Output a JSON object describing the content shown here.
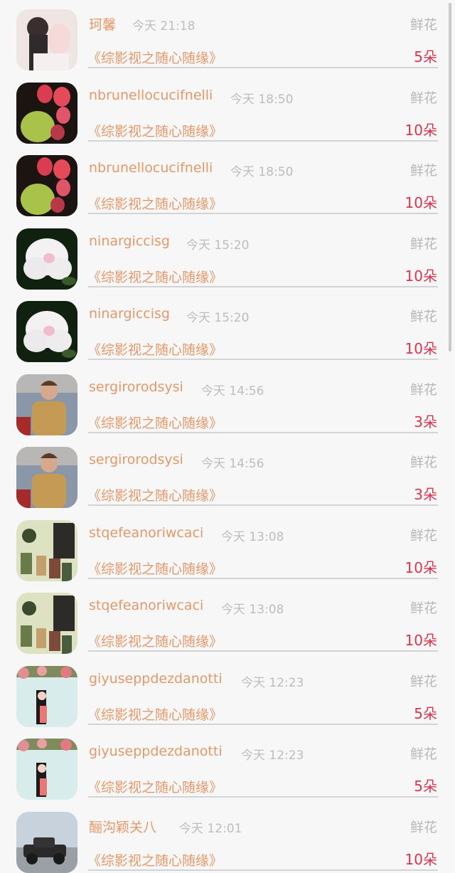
{
  "list": {
    "items": [
      {
        "name": "珂馨",
        "time": "今天 21:18",
        "gift": "鲜花",
        "work": "《综影视之随心随缘》",
        "count": "5朵",
        "avatar": "avatar-anime"
      },
      {
        "name": "nbrunellocucifnelli",
        "time": "今天 18:50",
        "gift": "鲜花",
        "work": "《综影视之随心随缘》",
        "count": "10朵",
        "avatar": "avatar-cactus-flower"
      },
      {
        "name": "nbrunellocucifnelli",
        "time": "今天 18:50",
        "gift": "鲜花",
        "work": "《综影视之随心随缘》",
        "count": "10朵",
        "avatar": "avatar-cactus-flower"
      },
      {
        "name": "ninargiccisg",
        "time": "今天 15:20",
        "gift": "鲜花",
        "work": "《综影视之随心随缘》",
        "count": "10朵",
        "avatar": "avatar-white-lotus"
      },
      {
        "name": "ninargiccisg",
        "time": "今天 15:20",
        "gift": "鲜花",
        "work": "《综影视之随心随缘》",
        "count": "10朵",
        "avatar": "avatar-white-lotus"
      },
      {
        "name": "sergirorodsysi",
        "time": "今天 14:56",
        "gift": "鲜花",
        "work": "《综影视之随心随缘》",
        "count": "3朵",
        "avatar": "avatar-man-sweater"
      },
      {
        "name": "sergirorodsysi",
        "time": "今天 14:56",
        "gift": "鲜花",
        "work": "《综影视之随心随缘》",
        "count": "3朵",
        "avatar": "avatar-man-sweater"
      },
      {
        "name": "stqefeanoriwcaci",
        "time": "今天 13:08",
        "gift": "鲜花",
        "work": "《综影视之随心随缘》",
        "count": "10朵",
        "avatar": "avatar-vintage-painting"
      },
      {
        "name": "stqefeanoriwcaci",
        "time": "今天 13:08",
        "gift": "鲜花",
        "work": "《综影视之随心随缘》",
        "count": "10朵",
        "avatar": "avatar-vintage-painting"
      },
      {
        "name": "giyuseppdezdanotti",
        "time": "今天 12:23",
        "gift": "鲜花",
        "work": "《综影视之随心随缘》",
        "count": "5朵",
        "avatar": "avatar-girl-flowers"
      },
      {
        "name": "giyuseppdezdanotti",
        "time": "今天 12:23",
        "gift": "鲜花",
        "work": "《综影视之随心随缘》",
        "count": "5朵",
        "avatar": "avatar-girl-flowers"
      },
      {
        "name": "酾沟颖关八",
        "time": "今天 12:01",
        "gift": "鲜花",
        "work": "《综影视之随心随缘》",
        "count": "10朵",
        "avatar": "avatar-vintage-car"
      }
    ]
  },
  "colors": {
    "name": "#e4986a",
    "work": "#e4986a",
    "count": "#d9344e",
    "time": "#bdbdbd",
    "gift": "#b8b8b8"
  }
}
